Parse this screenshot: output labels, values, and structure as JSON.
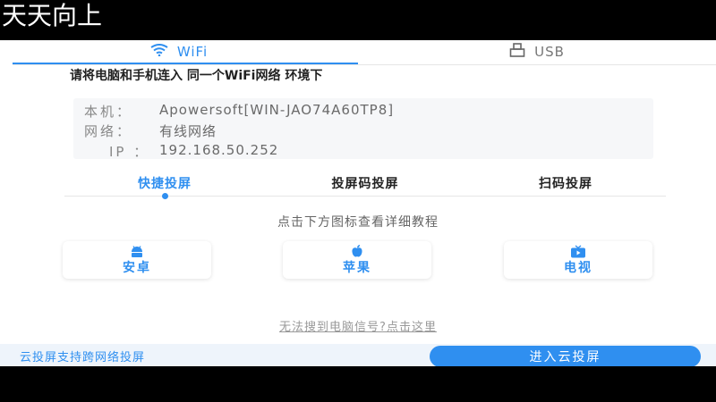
{
  "overlay": {
    "caption": "天天向上"
  },
  "connection_tabs": [
    {
      "label": "WiFi",
      "icon": "wifi-icon",
      "active": true
    },
    {
      "label": "USB",
      "icon": "usb-icon",
      "active": false
    }
  ],
  "instruction": {
    "prefix": "请将电脑和手机连入 ",
    "emphasis": "同一个WiFi网络",
    "suffix": " 环境下"
  },
  "device_info": {
    "host_label": "本机：",
    "host_value": "Apowersoft[WIN-JAO74A60TP8]",
    "network_label": "网络：",
    "network_value": "有线网络",
    "ip_label": "IP ：",
    "ip_value": "192.168.50.252"
  },
  "mode_tabs": [
    {
      "label": "快捷投屏",
      "active": true
    },
    {
      "label": "投屏码投屏",
      "active": false
    },
    {
      "label": "扫码投屏",
      "active": false
    }
  ],
  "hint": "点击下方图标查看详细教程",
  "platforms": [
    {
      "label": "安卓",
      "icon": "android-icon"
    },
    {
      "label": "苹果",
      "icon": "apple-icon"
    },
    {
      "label": "电视",
      "icon": "tv-icon"
    }
  ],
  "help_link": "无法搜到电脑信号?点击这里",
  "footer": {
    "text": "云投屏支持跨网络投屏",
    "button": "进入云投屏"
  },
  "colors": {
    "accent": "#2f8ff0",
    "footer_bg": "#eef4fb"
  }
}
